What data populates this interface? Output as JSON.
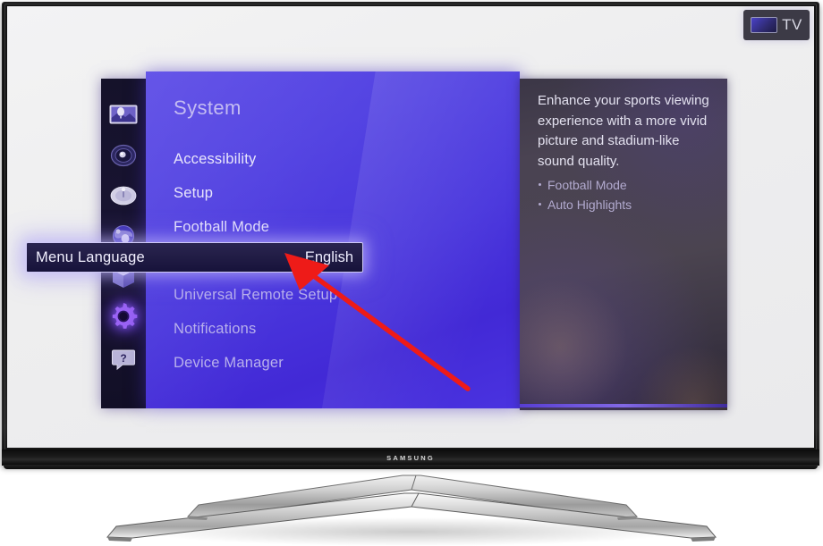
{
  "device": {
    "brand": "SAMSUNG",
    "type": "television"
  },
  "tv_source_badge": {
    "label": "TV",
    "icon": "tv-screen-icon"
  },
  "sidebar": {
    "items": [
      {
        "id": "picture",
        "icon": "picture-icon",
        "selected": false
      },
      {
        "id": "sound",
        "icon": "speaker-icon",
        "selected": false
      },
      {
        "id": "broadcast",
        "icon": "satellite-dish-icon",
        "selected": false
      },
      {
        "id": "network",
        "icon": "globe-network-icon",
        "selected": false
      },
      {
        "id": "smart-hub",
        "icon": "cube-icon",
        "selected": false
      },
      {
        "id": "system",
        "icon": "gear-icon",
        "selected": true
      },
      {
        "id": "support",
        "icon": "help-bubble-icon",
        "selected": false
      }
    ]
  },
  "menu": {
    "title": "System",
    "items": [
      {
        "label": "Accessibility",
        "value": "",
        "state": "bright",
        "selected": false
      },
      {
        "label": "Setup",
        "value": "",
        "state": "bright",
        "selected": false
      },
      {
        "label": "Football Mode",
        "value": "",
        "state": "bright",
        "selected": false
      },
      {
        "label": "Menu Language",
        "value": "English",
        "state": "selected",
        "selected": true
      },
      {
        "label": "Universal Remote Setup",
        "value": "",
        "state": "dim",
        "selected": false
      },
      {
        "label": "Notifications",
        "value": "",
        "state": "dim",
        "selected": false
      },
      {
        "label": "Device Manager",
        "value": "",
        "state": "dim",
        "selected": false
      }
    ],
    "scroll_indicator": "chevron-down-icon"
  },
  "info_panel": {
    "description": "Enhance your sports viewing experience with a more vivid picture and stadium-like sound quality.",
    "bullets": [
      "Football Mode",
      "Auto Highlights"
    ]
  },
  "annotation": {
    "type": "arrow",
    "color": "#ee1b18",
    "points_at": "Menu Language"
  },
  "colors": {
    "menu_accent": "#4a37dd",
    "selected_row_fill": "#221d46",
    "selected_row_border": "#cfc9f6",
    "arrow_red": "#ee1b18",
    "screen_white": "#eeeeef"
  }
}
